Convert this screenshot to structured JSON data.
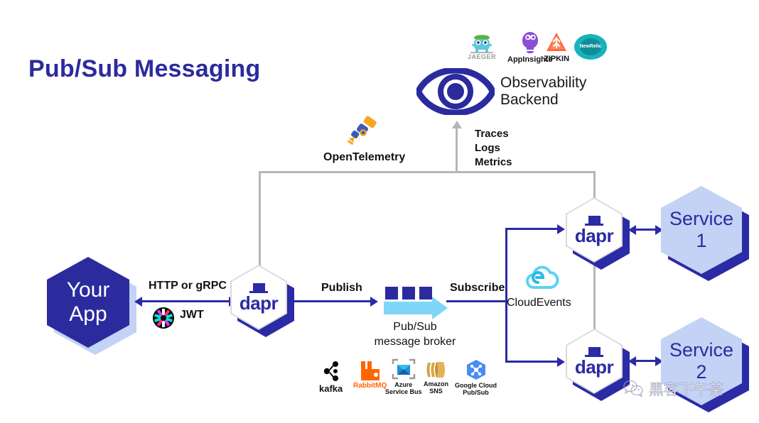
{
  "page": {
    "title": "Pub/Sub Messaging",
    "background": "#ffffff",
    "accent_dark_blue": "#2B2B9E",
    "accent_light_blue": "#C3D2F5",
    "accent_cyan": "#7FD6F7",
    "gray_line": "#b6b6b6"
  },
  "observability": {
    "eye_label_line1": "Observability",
    "eye_label_line2": "Backend",
    "telemetry_signals": [
      "Traces",
      "Logs",
      "Metrics"
    ],
    "instrumentation_label": "OpenTelemetry",
    "vendors": [
      {
        "name": "jaeger-logo",
        "label": "JAEGER"
      },
      {
        "name": "appinsights-logo",
        "label": "AppInsights"
      },
      {
        "name": "zipkin-logo",
        "label": "ZIPKIN"
      },
      {
        "name": "newrelic-logo",
        "label": "New Relic",
        "label_line1": "New",
        "label_line2": "Relic"
      }
    ]
  },
  "nodes": {
    "your_app": {
      "line1": "Your",
      "line2": "App"
    },
    "sidecar_app": {
      "label": "dapr"
    },
    "sidecar_service1": {
      "label": "dapr"
    },
    "sidecar_service2": {
      "label": "dapr"
    },
    "service1": {
      "line1": "Service",
      "line2": "1"
    },
    "service2": {
      "line1": "Service",
      "line2": "2"
    }
  },
  "edges": {
    "app_to_sidecar": "HTTP or gRPC",
    "app_auth": "JWT",
    "publish": "Publish",
    "subscribe": "Subscribe",
    "envelope_format": "CloudEvents"
  },
  "broker": {
    "line1": "Pub/Sub",
    "line2": "message broker",
    "implementations": [
      {
        "name": "kafka-logo",
        "label": "kafka"
      },
      {
        "name": "rabbitmq-logo",
        "label": "RabbitMQ"
      },
      {
        "name": "azure-service-bus-logo",
        "label_line1": "Azure",
        "label_line2": "Service Bus"
      },
      {
        "name": "amazon-sns-logo",
        "label_line1": "Amazon",
        "label_line2": "SNS"
      },
      {
        "name": "google-cloud-pubsub-logo",
        "label_line1": "Google Cloud",
        "label_line2": "Pub/Sub"
      }
    ]
  },
  "watermark": {
    "text": "黑客下午茶"
  }
}
